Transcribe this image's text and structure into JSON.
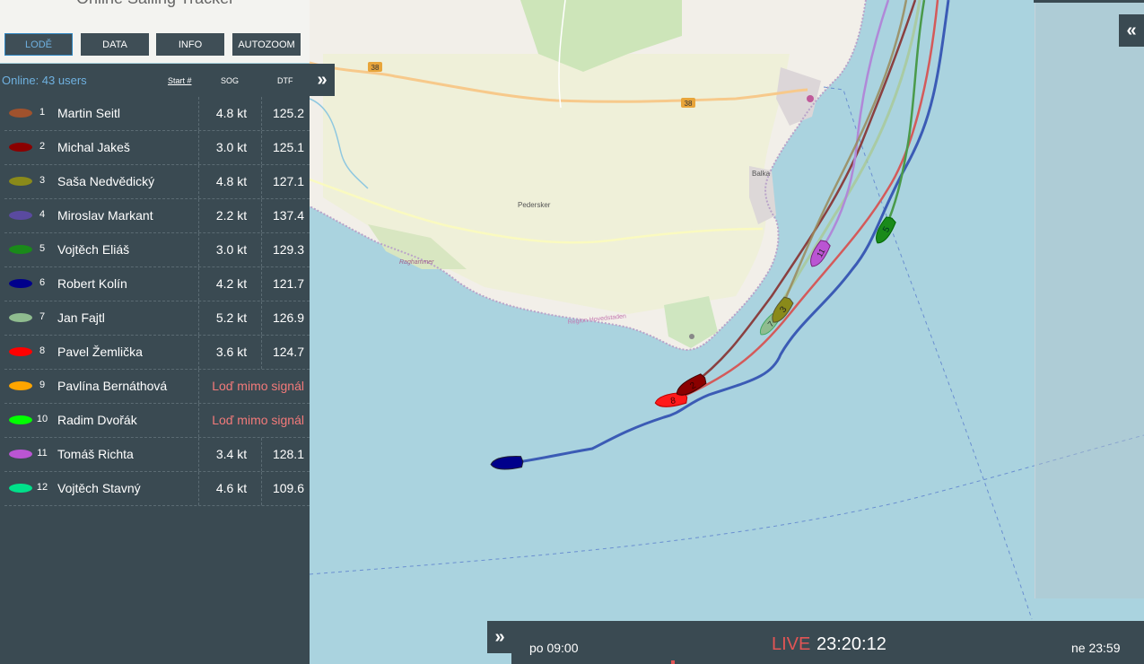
{
  "app": {
    "title": "Online Sailing Tracker"
  },
  "toolbar": {
    "buttons": [
      {
        "label": "LODĚ",
        "active": true
      },
      {
        "label": "DATA",
        "active": false
      },
      {
        "label": "INFO",
        "active": false
      },
      {
        "label": "AUTOZOOM",
        "active": false
      }
    ]
  },
  "panel": {
    "online": "Online: 43 users",
    "col_start": "Start #",
    "col_sog": "SOG",
    "col_dtf": "DTF",
    "collapse_icon": "»"
  },
  "boats": [
    {
      "num": "1",
      "name": "Martin Seitl",
      "sog": "4.8 kt",
      "dtf": "125.2",
      "color": "#a0522d"
    },
    {
      "num": "2",
      "name": "Michal Jakeš",
      "sog": "3.0 kt",
      "dtf": "125.1",
      "color": "#8b0000"
    },
    {
      "num": "3",
      "name": "Saša Nedvědický",
      "sog": "4.8 kt",
      "dtf": "127.1",
      "color": "#8a8a1a"
    },
    {
      "num": "4",
      "name": "Miroslav Markant",
      "sog": "2.2 kt",
      "dtf": "137.4",
      "color": "#5a4aa0"
    },
    {
      "num": "5",
      "name": "Vojtěch Eliáš",
      "sog": "3.0 kt",
      "dtf": "129.3",
      "color": "#1a8a1a"
    },
    {
      "num": "6",
      "name": "Robert Kolín",
      "sog": "4.2 kt",
      "dtf": "121.7",
      "color": "#00008b"
    },
    {
      "num": "7",
      "name": "Jan Fajtl",
      "sog": "5.2 kt",
      "dtf": "126.9",
      "color": "#8fbc8f"
    },
    {
      "num": "8",
      "name": "Pavel Žemlička",
      "sog": "3.6 kt",
      "dtf": "124.7",
      "color": "#ff0000"
    },
    {
      "num": "9",
      "name": "Pavlína Bernáthová",
      "status": "Loď mimo signál",
      "color": "#ffa500"
    },
    {
      "num": "10",
      "name": "Radim Dvořák",
      "status": "Loď mimo signál",
      "color": "#00ff00"
    },
    {
      "num": "11",
      "name": "Tomáš Richta",
      "sog": "3.4 kt",
      "dtf": "128.1",
      "color": "#ba55d3"
    },
    {
      "num": "12",
      "name": "Vojtěch Stavný",
      "sog": "4.6 kt",
      "dtf": "109.6",
      "color": "#00e08a"
    }
  ],
  "map": {
    "labels": {
      "road1": "38",
      "road2": "38",
      "town1": "Balka",
      "town2": "Pedersker",
      "place1": "Raghammer",
      "place2": "Region Hovedstaden"
    },
    "boat_markers": [
      "6",
      "8",
      "2",
      "7",
      "3",
      "11",
      "5"
    ]
  },
  "right_panel": {
    "expand_icon": "«"
  },
  "timeline": {
    "toggle_icon": "»",
    "start": "po 09:00",
    "live": "LIVE",
    "time": "23:20:12",
    "end": "ne 23:59"
  }
}
